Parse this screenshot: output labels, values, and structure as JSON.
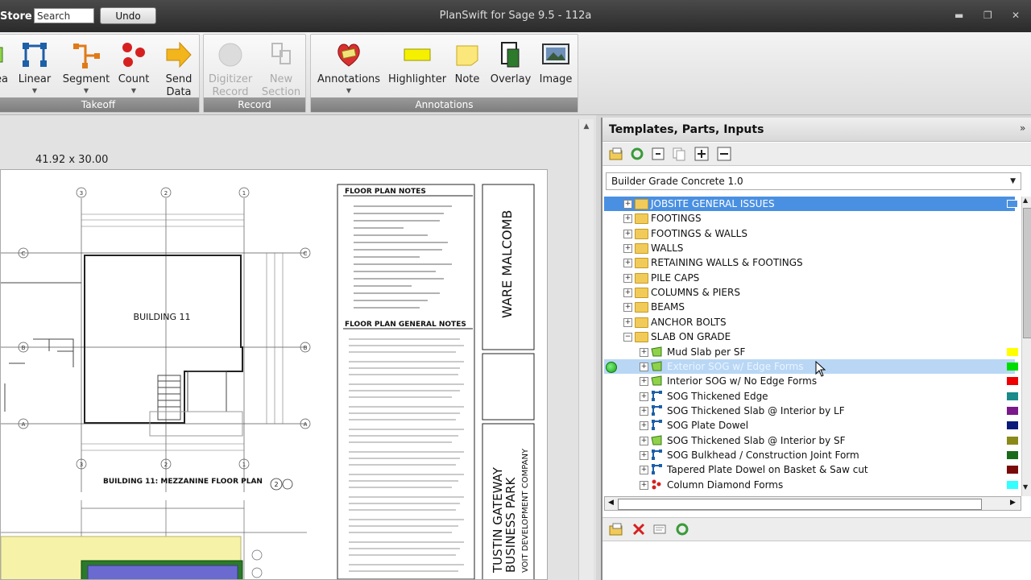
{
  "titlebar": {
    "store_label": "Store",
    "search_placeholder": "Search",
    "undo_label": "Undo",
    "app_title": "PlanSwift for Sage 9.5 - 112a"
  },
  "ribbon": {
    "takeoff": {
      "group_label": "Takeoff",
      "area_label": "ea",
      "linear_label": "Linear",
      "segment_label": "Segment",
      "count_label": "Count",
      "send_label": "Send",
      "data_label": "Data"
    },
    "record": {
      "group_label": "Record",
      "digitizer_line1": "Digitizer",
      "digitizer_line2": "Record",
      "new_line1": "New",
      "new_line2": "Section"
    },
    "annotations": {
      "group_label": "Annotations",
      "annotations_label": "Annotations",
      "highlighter_label": "Highlighter",
      "note_label": "Note",
      "overlay_label": "Overlay",
      "image_label": "Image"
    }
  },
  "canvas": {
    "size_label": "41.92 x 30.00",
    "building_label": "BUILDING 11",
    "mezz_label": "BUILDING 11: MEZZANINE FLOOR PLAN",
    "notes_title": "FLOOR PLAN NOTES",
    "general_notes_title": "FLOOR PLAN GENERAL NOTES",
    "firm_name": "WARE MALCOMB",
    "project_line1": "TUSTIN GATEWAY",
    "project_line2": "BUSINESS PARK",
    "developer": "VOIT DEVELOPMENT COMPANY"
  },
  "panel": {
    "title": "Templates, Parts, Inputs",
    "template_select": "Builder Grade Concrete 1.0",
    "tree": [
      {
        "label": "JOBSITE GENERAL ISSUES",
        "kind": "folder",
        "depth": 0,
        "state": "selected",
        "color": ""
      },
      {
        "label": "FOOTINGS",
        "kind": "folder",
        "depth": 0,
        "state": "",
        "color": ""
      },
      {
        "label": "FOOTINGS & WALLS",
        "kind": "folder",
        "depth": 0,
        "state": "",
        "color": ""
      },
      {
        "label": "WALLS",
        "kind": "folder",
        "depth": 0,
        "state": "",
        "color": ""
      },
      {
        "label": "RETAINING WALLS & FOOTINGS",
        "kind": "folder",
        "depth": 0,
        "state": "",
        "color": ""
      },
      {
        "label": "PILE CAPS",
        "kind": "folder",
        "depth": 0,
        "state": "",
        "color": ""
      },
      {
        "label": "COLUMNS & PIERS",
        "kind": "folder",
        "depth": 0,
        "state": "",
        "color": ""
      },
      {
        "label": "BEAMS",
        "kind": "folder",
        "depth": 0,
        "state": "",
        "color": ""
      },
      {
        "label": "ANCHOR BOLTS",
        "kind": "folder",
        "depth": 0,
        "state": "",
        "color": ""
      },
      {
        "label": "SLAB ON GRADE",
        "kind": "folder",
        "depth": 0,
        "state": "open",
        "color": ""
      },
      {
        "label": "Mud Slab per SF",
        "kind": "area",
        "depth": 1,
        "state": "",
        "color": "#ffff00"
      },
      {
        "label": "Exterior SOG w/ Edge Forms",
        "kind": "area",
        "depth": 1,
        "state": "hover",
        "color": "#00dd00"
      },
      {
        "label": "Interior SOG w/ No Edge Forms",
        "kind": "area",
        "depth": 1,
        "state": "",
        "color": "#ee0000"
      },
      {
        "label": "SOG Thickened Edge",
        "kind": "linear",
        "depth": 1,
        "state": "",
        "color": "#1a8a8a"
      },
      {
        "label": "SOG Thickened Slab @ Interior by LF",
        "kind": "linear",
        "depth": 1,
        "state": "",
        "color": "#7a1a8a"
      },
      {
        "label": "SOG Plate Dowel",
        "kind": "linear",
        "depth": 1,
        "state": "",
        "color": "#0a1a7a"
      },
      {
        "label": "SOG Thickened Slab @ Interior by SF",
        "kind": "area",
        "depth": 1,
        "state": "",
        "color": "#8a8a1a"
      },
      {
        "label": "SOG Bulkhead / Construction Joint Form",
        "kind": "linear",
        "depth": 1,
        "state": "",
        "color": "#1a6a1a"
      },
      {
        "label": "Tapered Plate Dowel on Basket & Saw cut",
        "kind": "linear",
        "depth": 1,
        "state": "",
        "color": "#7a0a0a"
      },
      {
        "label": "Column Diamond Forms",
        "kind": "count",
        "depth": 1,
        "state": "",
        "color": "#33ffff"
      }
    ]
  }
}
